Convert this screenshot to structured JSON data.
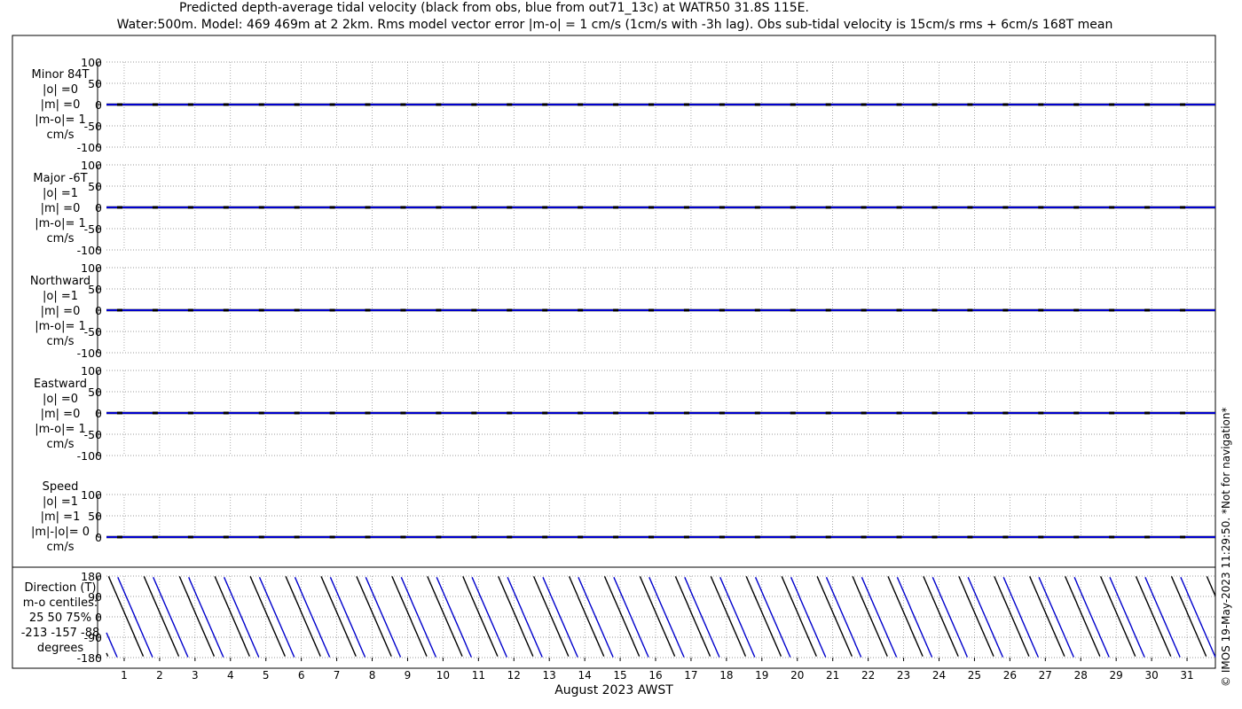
{
  "title_line1": "Predicted depth-average tidal velocity (black from obs, blue from out71_13c) at WATR50 31.8S 115E.",
  "title_line2": "Water:500m. Model: 469 469m at 2 2km. Rms model vector error |m-o| = 1 cm/s (1cm/s with -3h lag). Obs sub-tidal velocity is 15cm/s rms + 6cm/s 168T mean",
  "xlabel": "August 2023 AWST",
  "watermark": "© IMOS 19-May-2023 11:29:50. *Not for navigation*",
  "colors": {
    "obs": "#000000",
    "model": "#0000cc",
    "grid": "#777777"
  },
  "chart_data": [
    {
      "type": "line",
      "panel": "minor",
      "label_lines": [
        "Minor 84T",
        "|o| =0",
        "|m| =0",
        "|m-o|= 1",
        "cm/s"
      ],
      "ylim": [
        -100,
        100
      ],
      "yticks": [
        "100",
        "50",
        "0",
        "-50",
        "-100"
      ],
      "xlim": [
        0.5,
        31.8
      ],
      "series": [
        {
          "name": "obs",
          "values": [
            [
              0.5,
              0
            ],
            [
              31.8,
              0
            ]
          ]
        },
        {
          "name": "model",
          "values": [
            [
              0.5,
              0
            ],
            [
              31.8,
              0
            ]
          ]
        }
      ]
    },
    {
      "type": "line",
      "panel": "major",
      "label_lines": [
        "Major -6T",
        "|o| =1",
        "|m| =0",
        "|m-o|= 1",
        "cm/s"
      ],
      "ylim": [
        -100,
        100
      ],
      "yticks": [
        "100",
        "50",
        "0",
        "-50",
        "-100"
      ],
      "xlim": [
        0.5,
        31.8
      ],
      "series": [
        {
          "name": "obs",
          "values": [
            [
              0.5,
              0
            ],
            [
              31.8,
              0
            ]
          ]
        },
        {
          "name": "model",
          "values": [
            [
              0.5,
              0
            ],
            [
              31.8,
              0
            ]
          ]
        }
      ]
    },
    {
      "type": "line",
      "panel": "northward",
      "label_lines": [
        "Northward",
        "|o| =1",
        "|m| =0",
        "|m-o|= 1",
        "cm/s"
      ],
      "ylim": [
        -100,
        100
      ],
      "yticks": [
        "100",
        "50",
        "0",
        "-50",
        "-100"
      ],
      "xlim": [
        0.5,
        31.8
      ],
      "series": [
        {
          "name": "obs",
          "values": [
            [
              0.5,
              0
            ],
            [
              31.8,
              0
            ]
          ]
        },
        {
          "name": "model",
          "values": [
            [
              0.5,
              0
            ],
            [
              31.8,
              0
            ]
          ]
        }
      ]
    },
    {
      "type": "line",
      "panel": "eastward",
      "label_lines": [
        "Eastward",
        "|o| =0",
        "|m| =0",
        "|m-o|= 1",
        "cm/s"
      ],
      "ylim": [
        -100,
        100
      ],
      "yticks": [
        "100",
        "50",
        "0",
        "-50",
        "-100"
      ],
      "xlim": [
        0.5,
        31.8
      ],
      "series": [
        {
          "name": "obs",
          "values": [
            [
              0.5,
              0
            ],
            [
              31.8,
              0
            ]
          ]
        },
        {
          "name": "model",
          "values": [
            [
              0.5,
              0
            ],
            [
              31.8,
              0
            ]
          ]
        }
      ]
    },
    {
      "type": "line",
      "panel": "speed",
      "label_lines": [
        "Speed",
        "|o| =1",
        "|m| =1",
        "|m|-|o|= 0",
        "cm/s"
      ],
      "ylim": [
        0,
        100
      ],
      "yticks": [
        "100",
        "50",
        "0"
      ],
      "xlim": [
        0.5,
        31.8
      ],
      "series": [
        {
          "name": "obs",
          "values": [
            [
              0.5,
              0
            ],
            [
              31.8,
              0
            ]
          ]
        },
        {
          "name": "model",
          "values": [
            [
              0.5,
              0
            ],
            [
              31.8,
              0
            ]
          ]
        }
      ]
    },
    {
      "type": "line",
      "panel": "direction",
      "label_lines": [
        "Direction (T)",
        "m-o centiles:",
        "25  50  75%",
        "-213 -157  -88",
        "degrees"
      ],
      "ylim": [
        -180,
        180
      ],
      "yticks": [
        "180",
        "90",
        "0",
        "-90",
        "-180"
      ],
      "xlim": [
        0.5,
        31.8
      ],
      "series": [
        {
          "name": "obs",
          "period_days": 1.0,
          "phase_deg": 20
        },
        {
          "name": "model",
          "period_days": 1.0,
          "phase_deg": 110
        }
      ]
    }
  ],
  "xticks": [
    "1",
    "2",
    "3",
    "4",
    "5",
    "6",
    "7",
    "8",
    "9",
    "10",
    "11",
    "12",
    "13",
    "14",
    "15",
    "16",
    "17",
    "18",
    "19",
    "20",
    "21",
    "22",
    "23",
    "24",
    "25",
    "26",
    "27",
    "28",
    "29",
    "30",
    "31"
  ]
}
